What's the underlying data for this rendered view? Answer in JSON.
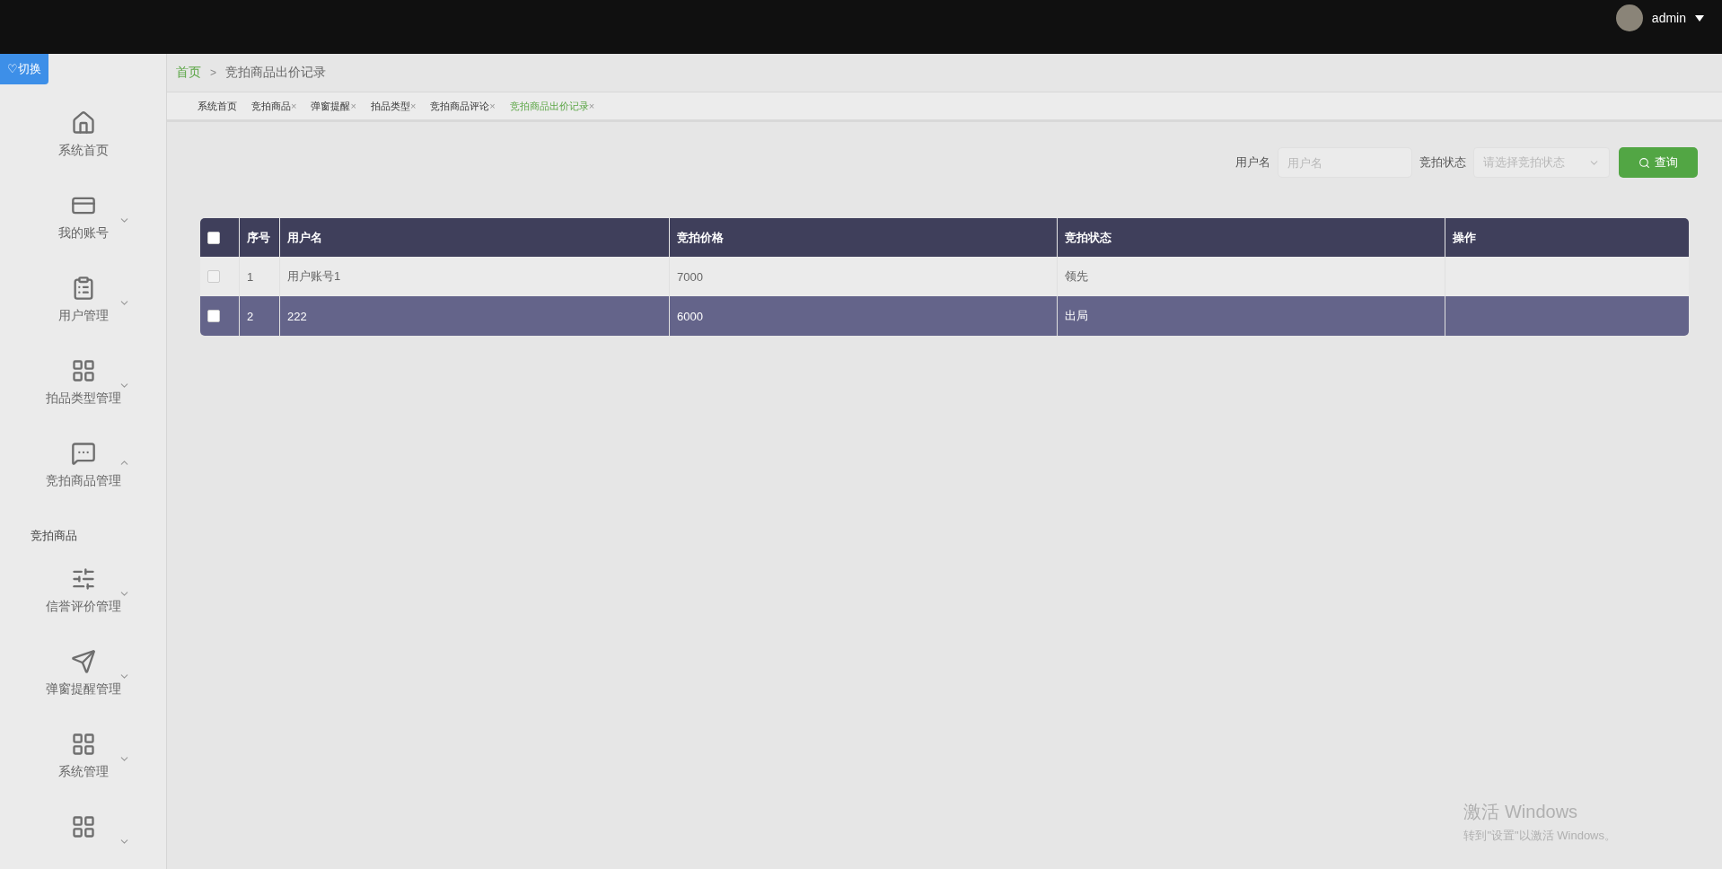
{
  "header": {
    "user": "admin"
  },
  "switch_button": "♡切换",
  "sidebar": {
    "items": [
      {
        "label": "系统首页"
      },
      {
        "label": "我的账号",
        "expanded": false
      },
      {
        "label": "用户管理",
        "expanded": false
      },
      {
        "label": "拍品类型管理",
        "expanded": false
      },
      {
        "label": "竞拍商品管理",
        "expanded": true,
        "children": [
          {
            "label": "竞拍商品"
          }
        ]
      },
      {
        "label": "信誉评价管理",
        "expanded": false
      },
      {
        "label": "弹窗提醒管理",
        "expanded": false
      },
      {
        "label": "系统管理",
        "expanded": false
      },
      {
        "expanded": false
      }
    ]
  },
  "breadcrumb": {
    "separator": ">",
    "items": [
      "首页",
      "竞拍商品出价记录"
    ]
  },
  "tabs": [
    {
      "label": "系统首页",
      "selected": false
    },
    {
      "label": "竞拍商品",
      "close": "×",
      "selected": false
    },
    {
      "label": "弹窗提醒",
      "close": "×",
      "selected": false
    },
    {
      "label": "拍品类型",
      "close": "×",
      "selected": false
    },
    {
      "label": "竞拍商品评论",
      "close": "×",
      "selected": false
    },
    {
      "label": "竞拍商品出价记录",
      "close": "×",
      "selected": true
    }
  ],
  "filters": {
    "username_label": "用户名",
    "username_placeholder": "用户名",
    "status_label": "竞拍状态",
    "status_placeholder": "请选择竞拍状态",
    "search_button": "查询"
  },
  "table": {
    "select_all_checked": false,
    "columns": [
      "序号",
      "用户名",
      "竞拍价格",
      "竞拍状态",
      "操作"
    ],
    "rows": [
      {
        "cells": [
          "1",
          "用户账号1",
          "7000",
          "领先"
        ],
        "checked": false,
        "selected": false
      },
      {
        "cells": [
          "2",
          "222",
          "6000",
          "出局"
        ],
        "checked": false,
        "selected": true
      }
    ]
  },
  "activation": {
    "title": "激活 Windows",
    "hint": "转到\"设置\"以激活 Windows。"
  }
}
